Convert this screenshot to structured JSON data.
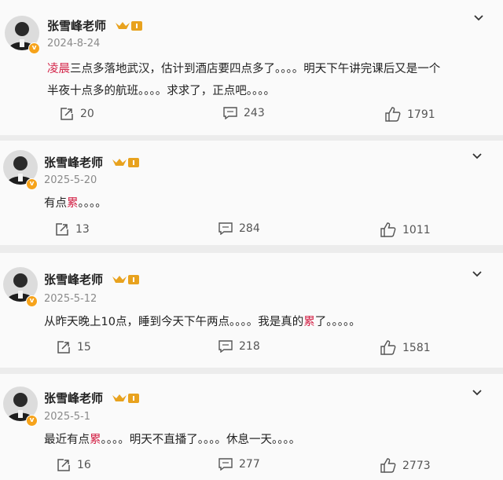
{
  "posts": [
    {
      "username": "张雪峰老师",
      "date": "2024-8-24",
      "line1_hl": "凌晨",
      "line1_rest": "三点多落地武汉，估计到酒店要四点多了。。。。明天下午讲完课后又是一个",
      "line2": "半夜十点多的航班。。。。求求了，正点吧。。。。",
      "reposts": "20",
      "comments": "243",
      "likes": "1791"
    },
    {
      "username": "张雪峰老师",
      "date": "2025-5-20",
      "text_pre": "有点",
      "text_hl": "累",
      "text_post": "。。。。",
      "reposts": "13",
      "comments": "284",
      "likes": "1011"
    },
    {
      "username": "张雪峰老师",
      "date": "2025-5-12",
      "text_pre": "从昨天晚上10点，睡到今天下午两点。。。。我是真的",
      "text_hl": "累",
      "text_post": "了。。。。。",
      "reposts": "15",
      "comments": "218",
      "likes": "1581"
    },
    {
      "username": "张雪峰老师",
      "date": "2025-5-1",
      "text_pre": "最近有点",
      "text_hl": "累",
      "text_post": "。。。。明天不直播了。。。。休息一天。。。。",
      "reposts": "16",
      "comments": "277",
      "likes": "2773"
    }
  ],
  "colors": {
    "highlight": "#d4264a",
    "badge": "#f6a31b",
    "crown": "#e8a21e"
  },
  "icons": {
    "verified": "v",
    "member": "crown-icon",
    "repost": "repost-icon",
    "comment": "comment-icon",
    "like": "thumbs-up-icon",
    "menu": "chevron-down-icon"
  }
}
